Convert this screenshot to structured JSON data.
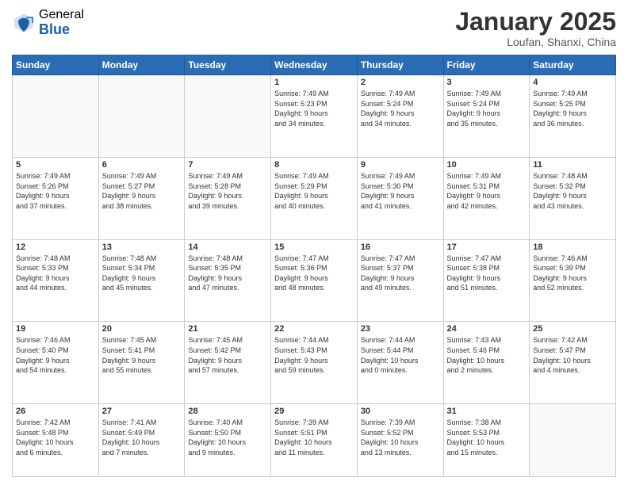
{
  "logo": {
    "general": "General",
    "blue": "Blue"
  },
  "header": {
    "month": "January 2025",
    "location": "Loufan, Shanxi, China"
  },
  "days": {
    "headers": [
      "Sunday",
      "Monday",
      "Tuesday",
      "Wednesday",
      "Thursday",
      "Friday",
      "Saturday"
    ]
  },
  "weeks": [
    [
      {
        "num": "",
        "empty": true,
        "lines": []
      },
      {
        "num": "",
        "empty": true,
        "lines": []
      },
      {
        "num": "",
        "empty": true,
        "lines": []
      },
      {
        "num": "1",
        "lines": [
          "Sunrise: 7:49 AM",
          "Sunset: 5:23 PM",
          "Daylight: 9 hours",
          "and 34 minutes."
        ]
      },
      {
        "num": "2",
        "lines": [
          "Sunrise: 7:49 AM",
          "Sunset: 5:24 PM",
          "Daylight: 9 hours",
          "and 34 minutes."
        ]
      },
      {
        "num": "3",
        "lines": [
          "Sunrise: 7:49 AM",
          "Sunset: 5:24 PM",
          "Daylight: 9 hours",
          "and 35 minutes."
        ]
      },
      {
        "num": "4",
        "lines": [
          "Sunrise: 7:49 AM",
          "Sunset: 5:25 PM",
          "Daylight: 9 hours",
          "and 36 minutes."
        ]
      }
    ],
    [
      {
        "num": "5",
        "lines": [
          "Sunrise: 7:49 AM",
          "Sunset: 5:26 PM",
          "Daylight: 9 hours",
          "and 37 minutes."
        ]
      },
      {
        "num": "6",
        "lines": [
          "Sunrise: 7:49 AM",
          "Sunset: 5:27 PM",
          "Daylight: 9 hours",
          "and 38 minutes."
        ]
      },
      {
        "num": "7",
        "lines": [
          "Sunrise: 7:49 AM",
          "Sunset: 5:28 PM",
          "Daylight: 9 hours",
          "and 39 minutes."
        ]
      },
      {
        "num": "8",
        "lines": [
          "Sunrise: 7:49 AM",
          "Sunset: 5:29 PM",
          "Daylight: 9 hours",
          "and 40 minutes."
        ]
      },
      {
        "num": "9",
        "lines": [
          "Sunrise: 7:49 AM",
          "Sunset: 5:30 PM",
          "Daylight: 9 hours",
          "and 41 minutes."
        ]
      },
      {
        "num": "10",
        "lines": [
          "Sunrise: 7:49 AM",
          "Sunset: 5:31 PM",
          "Daylight: 9 hours",
          "and 42 minutes."
        ]
      },
      {
        "num": "11",
        "lines": [
          "Sunrise: 7:48 AM",
          "Sunset: 5:32 PM",
          "Daylight: 9 hours",
          "and 43 minutes."
        ]
      }
    ],
    [
      {
        "num": "12",
        "lines": [
          "Sunrise: 7:48 AM",
          "Sunset: 5:33 PM",
          "Daylight: 9 hours",
          "and 44 minutes."
        ]
      },
      {
        "num": "13",
        "lines": [
          "Sunrise: 7:48 AM",
          "Sunset: 5:34 PM",
          "Daylight: 9 hours",
          "and 45 minutes."
        ]
      },
      {
        "num": "14",
        "lines": [
          "Sunrise: 7:48 AM",
          "Sunset: 5:35 PM",
          "Daylight: 9 hours",
          "and 47 minutes."
        ]
      },
      {
        "num": "15",
        "lines": [
          "Sunrise: 7:47 AM",
          "Sunset: 5:36 PM",
          "Daylight: 9 hours",
          "and 48 minutes."
        ]
      },
      {
        "num": "16",
        "lines": [
          "Sunrise: 7:47 AM",
          "Sunset: 5:37 PM",
          "Daylight: 9 hours",
          "and 49 minutes."
        ]
      },
      {
        "num": "17",
        "lines": [
          "Sunrise: 7:47 AM",
          "Sunset: 5:38 PM",
          "Daylight: 9 hours",
          "and 51 minutes."
        ]
      },
      {
        "num": "18",
        "lines": [
          "Sunrise: 7:46 AM",
          "Sunset: 5:39 PM",
          "Daylight: 9 hours",
          "and 52 minutes."
        ]
      }
    ],
    [
      {
        "num": "19",
        "lines": [
          "Sunrise: 7:46 AM",
          "Sunset: 5:40 PM",
          "Daylight: 9 hours",
          "and 54 minutes."
        ]
      },
      {
        "num": "20",
        "lines": [
          "Sunrise: 7:45 AM",
          "Sunset: 5:41 PM",
          "Daylight: 9 hours",
          "and 55 minutes."
        ]
      },
      {
        "num": "21",
        "lines": [
          "Sunrise: 7:45 AM",
          "Sunset: 5:42 PM",
          "Daylight: 9 hours",
          "and 57 minutes."
        ]
      },
      {
        "num": "22",
        "lines": [
          "Sunrise: 7:44 AM",
          "Sunset: 5:43 PM",
          "Daylight: 9 hours",
          "and 59 minutes."
        ]
      },
      {
        "num": "23",
        "lines": [
          "Sunrise: 7:44 AM",
          "Sunset: 5:44 PM",
          "Daylight: 10 hours",
          "and 0 minutes."
        ]
      },
      {
        "num": "24",
        "lines": [
          "Sunrise: 7:43 AM",
          "Sunset: 5:46 PM",
          "Daylight: 10 hours",
          "and 2 minutes."
        ]
      },
      {
        "num": "25",
        "lines": [
          "Sunrise: 7:42 AM",
          "Sunset: 5:47 PM",
          "Daylight: 10 hours",
          "and 4 minutes."
        ]
      }
    ],
    [
      {
        "num": "26",
        "lines": [
          "Sunrise: 7:42 AM",
          "Sunset: 5:48 PM",
          "Daylight: 10 hours",
          "and 6 minutes."
        ]
      },
      {
        "num": "27",
        "lines": [
          "Sunrise: 7:41 AM",
          "Sunset: 5:49 PM",
          "Daylight: 10 hours",
          "and 7 minutes."
        ]
      },
      {
        "num": "28",
        "lines": [
          "Sunrise: 7:40 AM",
          "Sunset: 5:50 PM",
          "Daylight: 10 hours",
          "and 9 minutes."
        ]
      },
      {
        "num": "29",
        "lines": [
          "Sunrise: 7:39 AM",
          "Sunset: 5:51 PM",
          "Daylight: 10 hours",
          "and 11 minutes."
        ]
      },
      {
        "num": "30",
        "lines": [
          "Sunrise: 7:39 AM",
          "Sunset: 5:52 PM",
          "Daylight: 10 hours",
          "and 13 minutes."
        ]
      },
      {
        "num": "31",
        "lines": [
          "Sunrise: 7:38 AM",
          "Sunset: 5:53 PM",
          "Daylight: 10 hours",
          "and 15 minutes."
        ]
      },
      {
        "num": "",
        "empty": true,
        "lines": []
      }
    ]
  ]
}
